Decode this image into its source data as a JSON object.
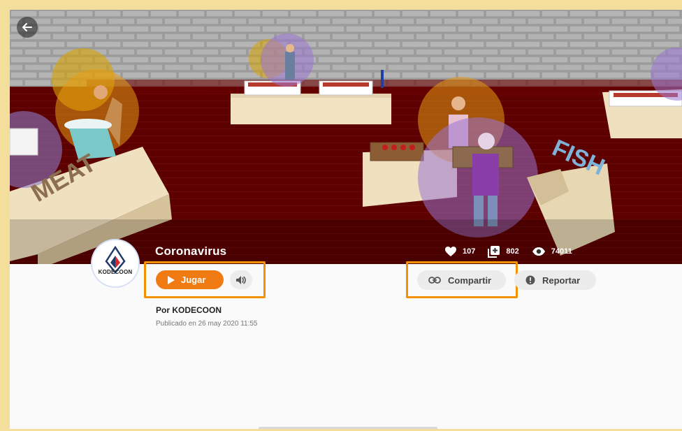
{
  "colors": {
    "accent": "#f07b12",
    "highlight": "#f39200",
    "pill_bg": "#ececec"
  },
  "hero": {
    "sign_meat": "MEAT",
    "sign_right": "FISH"
  },
  "header": {
    "back_icon": "arrow-left-icon"
  },
  "game": {
    "title": "Coronavirus",
    "stats": {
      "likes": "107",
      "added": "802",
      "views": "74011"
    },
    "author_logo_text": "KODECOON",
    "play_label": "Jugar",
    "share_label": "Compartir",
    "report_label": "Reportar",
    "author_line": "Por KODECOON",
    "published_line": "Publicado en 26 may 2020 11:55"
  }
}
